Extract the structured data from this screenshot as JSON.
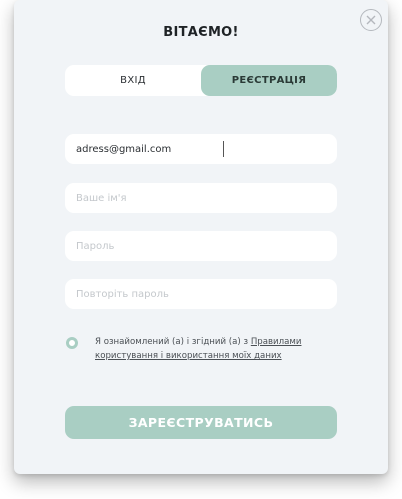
{
  "dialog": {
    "title": "ВІТАЄМО!",
    "close_icon": "close-circle-icon"
  },
  "tabs": [
    {
      "label": "ВХІД",
      "active": false
    },
    {
      "label": "РЕЄСТРАЦІЯ",
      "active": true
    }
  ],
  "form": {
    "email": {
      "value": "adress@gmail.com",
      "placeholder": ""
    },
    "name": {
      "value": "",
      "placeholder": "Ваше ім'я"
    },
    "password": {
      "value": "",
      "placeholder": "Пароль"
    },
    "password_repeat": {
      "value": "",
      "placeholder": "Повторіть пароль"
    }
  },
  "agreement": {
    "text_before": "Я ознайомлений (а) і згідний (а) з ",
    "link_text": "Правилами користування і використання моїх даних"
  },
  "submit_label": "ЗАРЕЄСТРУВАТИСЬ",
  "colors": {
    "accent": "#a9cec3",
    "background": "#f1f4f7",
    "field_bg": "#ffffff"
  }
}
